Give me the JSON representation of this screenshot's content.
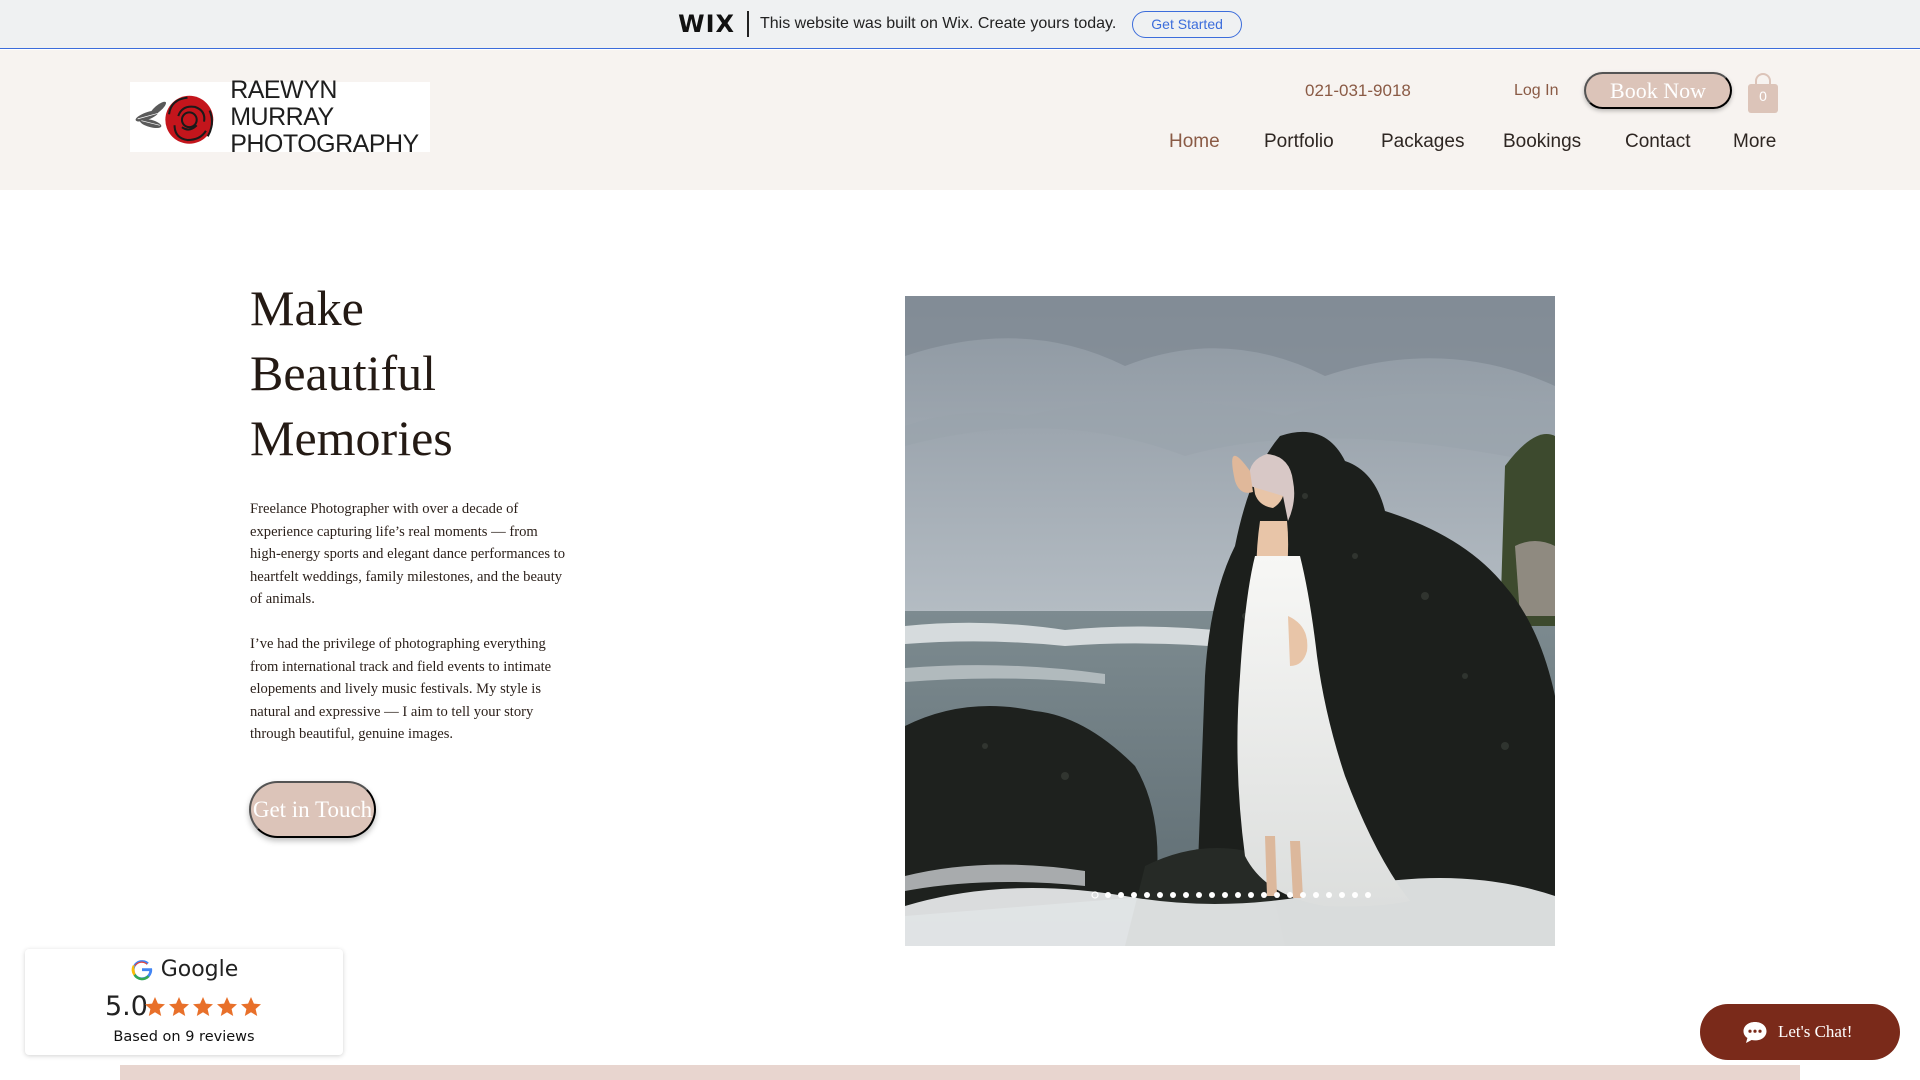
{
  "wix_banner": {
    "logo": "WIX",
    "message": "This website was built on Wix. Create yours today.",
    "cta": "Get Started"
  },
  "header": {
    "logo": {
      "line1": "RAEWYN MURRAY",
      "line2": "PHOTOGRAPHY"
    },
    "phone": "021-031-9018",
    "login_label": "Log In",
    "book_label": "Book Now",
    "cart_count": "0",
    "nav": [
      {
        "label": "Home",
        "active": true
      },
      {
        "label": "Portfolio",
        "active": false
      },
      {
        "label": "Packages",
        "active": false
      },
      {
        "label": "Bookings",
        "active": false
      },
      {
        "label": "Contact",
        "active": false
      },
      {
        "label": "More",
        "active": false
      }
    ]
  },
  "hero": {
    "title_lines": [
      "Make",
      "Beautiful",
      "Memories"
    ],
    "paragraph1": "Freelance Photographer with over a decade of experience capturing life’s real moments — from high-energy sports and elegant dance performances to heartfelt weddings, family milestones, and the beauty of animals.",
    "paragraph2": "I’ve had the privilege of photographing everything from international track and field events to intimate elopements and lively music festivals. My style is natural and expressive — I aim to tell your story through beautiful, genuine images.",
    "cta": "Get in Touch",
    "slideshow": {
      "slide_count": 22,
      "current_slide": 1
    }
  },
  "google_badge": {
    "name": "Google",
    "score": "5.0",
    "stars": 5,
    "reviews_text": "Based on 9 reviews"
  },
  "chat": {
    "label": "Let's Chat!"
  },
  "colors": {
    "accent": "#8a5a45",
    "button_fill": "#dcc4b9",
    "header_bg": "#f7f3f0",
    "wix_blue": "#3c6ddb",
    "chat_bg": "#7a2a1a",
    "star": "#e8702a"
  }
}
